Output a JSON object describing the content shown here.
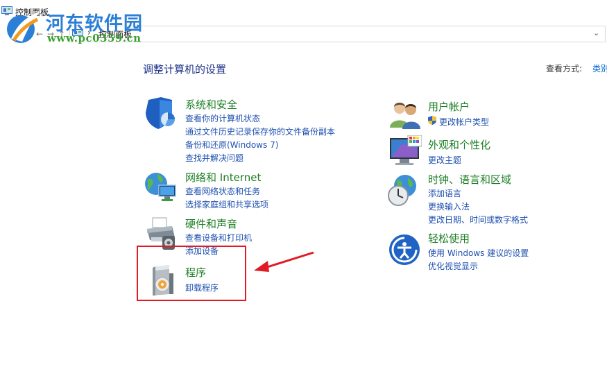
{
  "window": {
    "title": "控制面板"
  },
  "watermark": {
    "title": "河东软件园",
    "url": "www.pc0359.cn"
  },
  "address": {
    "path": "控制面板",
    "back": "←",
    "forward": "→",
    "up": "↑",
    "dropdown": "⌄"
  },
  "main": {
    "heading": "调整计算机的设置",
    "view_label": "查看方式:",
    "view_value": "类别"
  },
  "categories": [
    {
      "title": "系统和安全",
      "icon": "shield-icon",
      "links": [
        "查看你的计算机状态",
        "通过文件历史记录保存你的文件备份副本",
        "备份和还原(Windows 7)",
        "查找并解决问题"
      ]
    },
    {
      "title": "网络和 Internet",
      "icon": "globe-network-icon",
      "links": [
        "查看网络状态和任务",
        "选择家庭组和共享选项"
      ]
    },
    {
      "title": "硬件和声音",
      "icon": "printer-icon",
      "links": [
        "查看设备和打印机",
        "添加设备"
      ]
    },
    {
      "title": "程序",
      "icon": "programs-icon",
      "links": [
        "卸载程序"
      ]
    },
    {
      "title": "用户帐户",
      "icon": "users-icon",
      "links": [
        "更改帐户类型"
      ]
    },
    {
      "title": "外观和个性化",
      "icon": "monitor-palette-icon",
      "links": [
        "更改主题"
      ]
    },
    {
      "title": "时钟、语言和区域",
      "icon": "clock-globe-icon",
      "links": [
        "添加语言",
        "更换输入法",
        "更改日期、时间或数字格式"
      ]
    },
    {
      "title": "轻松使用",
      "icon": "ease-of-access-icon",
      "links": [
        "使用 Windows 建议的设置",
        "优化视觉显示"
      ]
    }
  ],
  "colors": {
    "highlight": "#e01b24",
    "link": "#1e50b0",
    "category_title": "#1b7d23",
    "heading": "#1e3287"
  }
}
